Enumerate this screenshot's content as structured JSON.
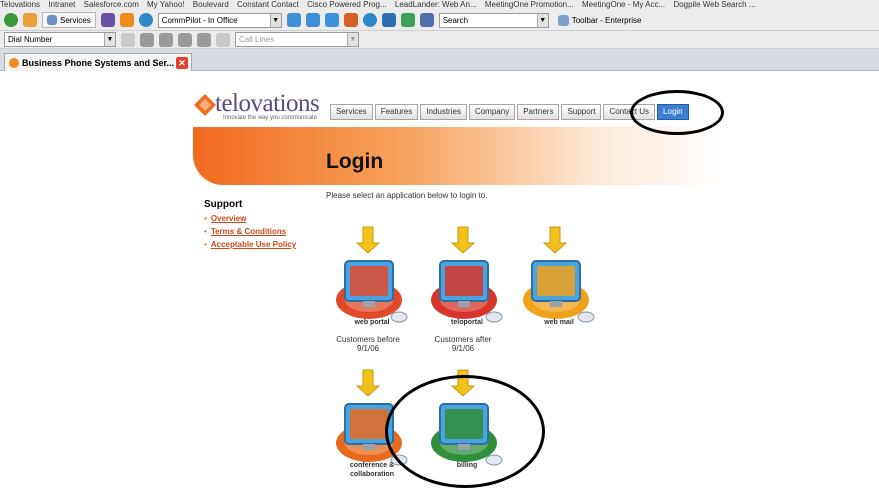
{
  "bookmarks": [
    "Telovations",
    "Intranet",
    "Salesforce.com",
    "My Yahoo!",
    "Boulevard",
    "Constant Contact",
    "Cisco Powered Prog...",
    "LeadLander: Web An...",
    "MeetingOne Promotion...",
    "MeetingOne - My Acc...",
    "Dogpile Web Search ..."
  ],
  "toolbar1": {
    "services": "Services",
    "status": "CommPilot - In Office",
    "search": "Search",
    "toolbar_label": "Toolbar - Enterprise"
  },
  "toolbar2": {
    "dial": "Dial Number",
    "call_lines": "Call Lines"
  },
  "tab": {
    "title": "Business Phone Systems and Ser..."
  },
  "logo": {
    "name": "telovations",
    "tagline": "Innovate the way you communicate"
  },
  "nav": [
    "Services",
    "Features",
    "Industries",
    "Company",
    "Partners",
    "Support",
    "Contact Us",
    "Login"
  ],
  "page": {
    "title": "Login",
    "intro": "Please select an application below to login to.",
    "support_heading": "Support",
    "support_links": [
      "Overview",
      "Terms & Conditions",
      "Acceptable Use Policy"
    ]
  },
  "apps": [
    {
      "label": "web portal",
      "caption": "Customers before 9/1/06",
      "color": "#e04a2a",
      "icon": "grid-icon"
    },
    {
      "label": "teloportal",
      "caption": "Customers after 9/1/06",
      "color": "#d8352a",
      "icon": "phone-icon"
    },
    {
      "label": "web mail",
      "caption": "",
      "color": "#f0a21a",
      "icon": "envelope-icon"
    },
    {
      "label": "conference & collaboration",
      "caption": "",
      "color": "#e86a1e",
      "icon": "people-icon"
    },
    {
      "label": "billing",
      "caption": "",
      "color": "#2f8f3a",
      "icon": "dollar-icon"
    }
  ]
}
